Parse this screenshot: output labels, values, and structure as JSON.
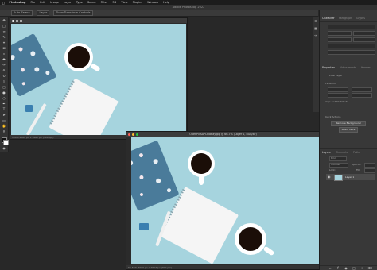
{
  "menubar": {
    "apple": "",
    "items": [
      "Photoshop",
      "File",
      "Edit",
      "Image",
      "Layer",
      "Type",
      "Select",
      "Filter",
      "3D",
      "View",
      "Plugins",
      "Window",
      "Help"
    ]
  },
  "titlebar": {
    "title": "Adobe Photoshop 2022"
  },
  "optionsbar": {
    "auto_select": "Auto-Select:",
    "layer_select": "Layer",
    "show_transform": "Show Transform Controls"
  },
  "doc_back": {
    "title": "",
    "status": "100%     4000 px x 2667 px (300 ppi)"
  },
  "doc_front": {
    "title": "OpenPlusAPI-Flatlay.jpg @ 66.7% (Layer 1, RGB/8*)",
    "status": "66.67%     4000 px x 2667 px (300 ppi)"
  },
  "properties_panel": {
    "tabs": [
      "Character",
      "Paragraph",
      "Glyphs"
    ],
    "sections": [
      "Properties",
      "Adjustments",
      "Libraries"
    ],
    "pixel_layer": "Pixel Layer",
    "transform": "Transform",
    "align": "Align and Distribute",
    "quick_actions": "Quick Actions",
    "remove_bg": "Remove Background",
    "learn_more": "Learn More"
  },
  "layers_panel": {
    "tabs": [
      "Layers",
      "Channels",
      "Paths"
    ],
    "kind": "Kind",
    "blend": "Normal",
    "opacity": "Opacity:",
    "lock": "Lock:",
    "fill": "Fill:",
    "layer_name": "Layer 1"
  },
  "colors": {
    "canvas_bg": "#a6d4de",
    "notebook": "#4a7b9a",
    "page": "#f5f5f5",
    "cup": "#ffffff",
    "coffee": "#1b0e08"
  }
}
